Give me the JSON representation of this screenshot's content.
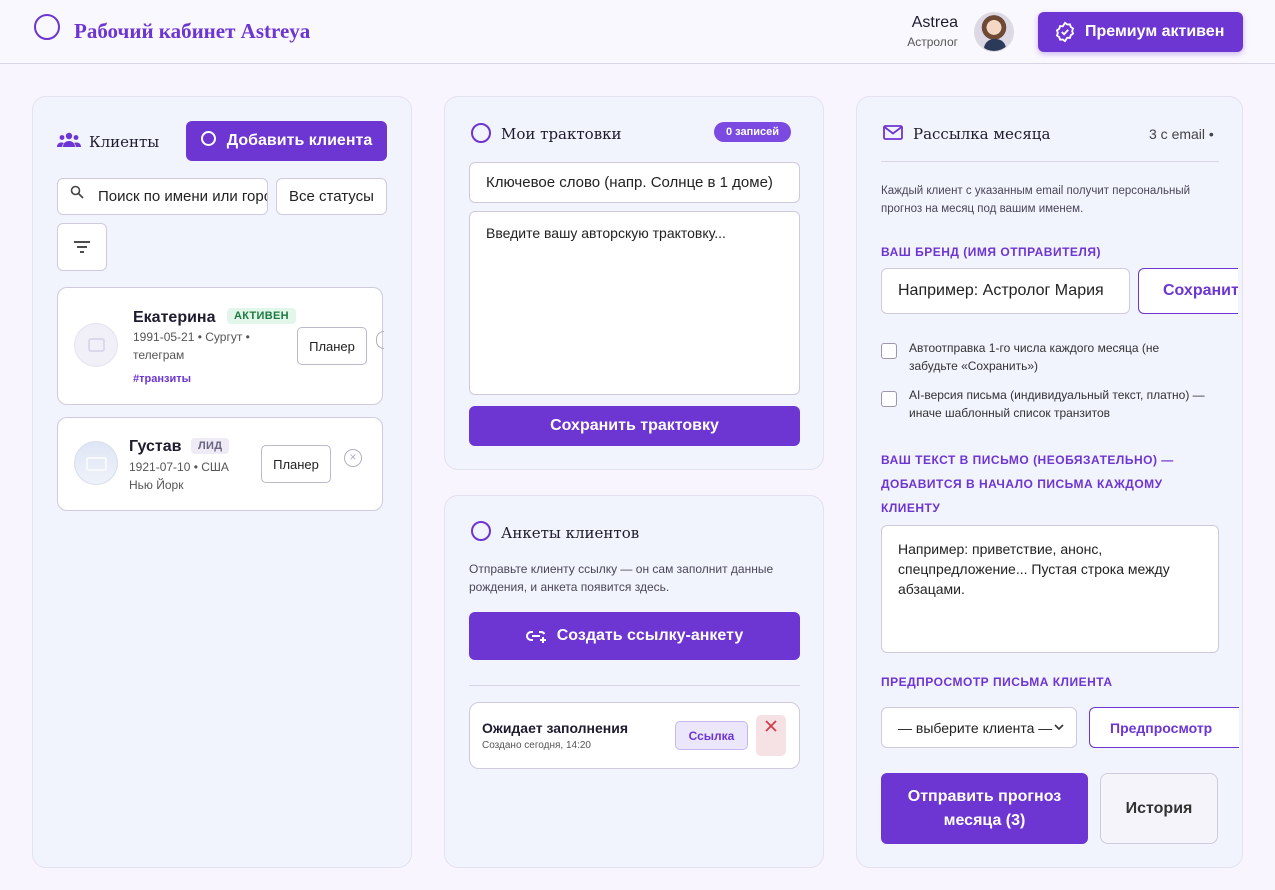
{
  "header": {
    "app_title": "Рабочий кабинет Astreya",
    "user_name": "Astrea",
    "user_role": "Астролог",
    "premium_label": "Премиум активен"
  },
  "clients": {
    "title": "Клиенты",
    "add_button": "Добавить клиента",
    "search_placeholder": "Поиск по имени или городу",
    "status_filter": "Все статусы",
    "items": [
      {
        "name": "Екатерина",
        "status": "АКТИВЕН",
        "meta_line1": "1991-05-21 • Сургут •",
        "meta_line2": "телеграм",
        "tag": "#транзиты",
        "planner": "Планер"
      },
      {
        "name": "Густав",
        "status": "ЛИД",
        "meta_line1": "1921-07-10 • США",
        "meta_line2": "Нью Йорк",
        "planner": "Планер"
      }
    ]
  },
  "interpretations": {
    "title": "Мои трактовки",
    "count_badge": "0 записей",
    "keyword_placeholder": "Ключевое слово (напр. Солнце в 1 доме)",
    "text_placeholder": "Введите вашу авторскую трактовку...",
    "save_button": "Сохранить трактовку"
  },
  "questionnaires": {
    "title": "Анкеты клиентов",
    "hint": "Отправьте клиенту ссылку — он сам заполнит данные рождения, и анкета появится здесь.",
    "create_button": "Создать ссылку-анкету",
    "pending": {
      "title": "Ожидает заполнения",
      "created": "Создано сегодня, 14:20",
      "link_label": "Ссылка"
    }
  },
  "mailing": {
    "title": "Рассылка месяца",
    "email_count": "3 с email •",
    "description": "Каждый клиент с указанным email получит персональный прогноз на месяц под вашим именем.",
    "brand_label": "ВАШ БРЕНД (ИМЯ ОТПРАВИТЕЛЯ)",
    "brand_placeholder": "Например: Астролог Мария",
    "save_button": "Сохранить",
    "autosend_label": "Автоотправка 1-го числа каждого месяца (не забудьте «Сохранить»)",
    "ai_label": "AI-версия письма (индивидуальный текст, платно) — иначе шаблонный список транзитов",
    "text_label": "ВАШ ТЕКСТ В ПИСЬМО (НЕОБЯЗАТЕЛЬНО) — ДОБАВИТСЯ В НАЧАЛО ПИСЬМА КАЖДОМУ КЛИЕНТУ",
    "text_placeholder": "Например: приветствие, анонс, спецпредложение... Пустая строка между абзацами.",
    "preview_label": "ПРЕДПРОСМОТР ПИСЬМА КЛИЕНТА",
    "client_select": "— выберите клиента —",
    "preview_button": "Предпросмотр",
    "send_button": "Отправить прогноз месяца (3)",
    "history_button": "История"
  },
  "colors": {
    "accent": "#6d35d1",
    "background": "#f8f5fe",
    "card": "#f1f3fd"
  }
}
